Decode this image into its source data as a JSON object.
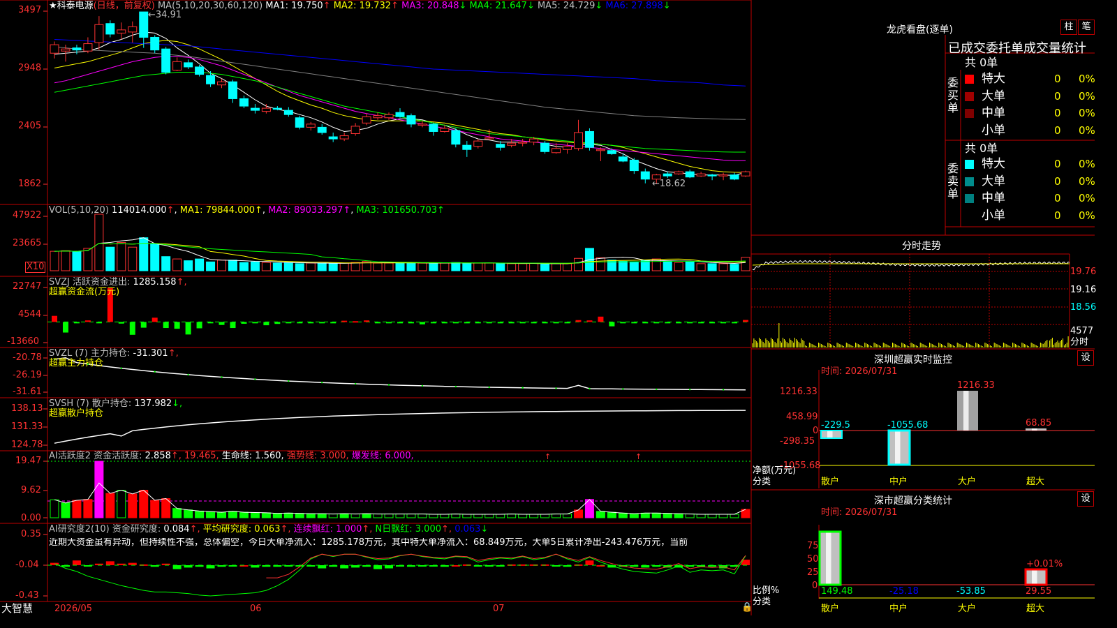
{
  "header": {
    "star": "★",
    "stock": "科泰电源",
    "mode": "(日线，前复权)",
    "ma_prefix": "MA(5,10,20,30,60,120)",
    "ma": [
      {
        "label": "MA1: 19.750",
        "arrow": "↑",
        "color": "#ffffff"
      },
      {
        "label": "MA2: 19.732",
        "arrow": "↑",
        "color": "#ffff00"
      },
      {
        "label": "MA3: 20.848",
        "arrow": "↓",
        "color": "#ff00ff"
      },
      {
        "label": "MA4: 21.647",
        "arrow": "↓",
        "color": "#00ff00"
      },
      {
        "label": "MA5: 24.729",
        "arrow": "↓",
        "color": "#c0c0c0"
      },
      {
        "label": "MA6: 27.898",
        "arrow": "↓",
        "color": "#0000ff"
      }
    ]
  },
  "colors": {
    "up": "#ff3232",
    "down": "#00ffff",
    "red": "#ff0000",
    "green": "#00ff00",
    "grid": "#c00000",
    "yellow": "#ffff00",
    "magenta": "#ff00ff",
    "blue": "#0000ff"
  },
  "price": {
    "y_labels": [
      "3497",
      "2948",
      "2405",
      "1862"
    ],
    "high_label": "34.91",
    "low_label": "←18.62",
    "high_prefix": "←"
  },
  "vol": {
    "title": "VOL(5,10,20)",
    "value": "114014.000",
    "arrow": "↑",
    "ma1": "MA1: 79844.000↑",
    "ma2": "MA2: 89033.297↑",
    "ma3": "MA3: 101650.703↑",
    "y_labels": [
      "47922",
      "23665"
    ],
    "mult": "X10"
  },
  "svzj": {
    "title": "SVZJ  活跃资金进出:",
    "value": "1285.158",
    "arrow": "↑,",
    "sub": "超赢资金流(万元)",
    "y_labels": [
      "22747",
      "4544",
      "-13660"
    ]
  },
  "svzl": {
    "title": "SVZL (7) 主力持仓:",
    "value": "-31.301",
    "arrow": "↑,",
    "sub": "超赢主力持仓",
    "y_labels": [
      "-20.78",
      "-26.19",
      "-31.61"
    ]
  },
  "svsh": {
    "title": "SVSH (7) 散户持仓:",
    "value": "137.982",
    "arrow": "↓,",
    "sub": "超赢散户持仓",
    "y_labels": [
      "138.13",
      "131.33",
      "124.78"
    ]
  },
  "ai2": {
    "title": "AI活跃度2 资金活跃度:",
    "value": "2.858",
    "v2": "↑, 19.465,",
    "life": "生命线: 1.560,",
    "strong": "强势线: 3.000,",
    "burst": "爆发线: 6.000,",
    "y_labels": [
      "19.47",
      "9.62",
      "0.00"
    ]
  },
  "ai_res": {
    "title": "AI研究度2(10) 资金研究度:",
    "value": "0.084",
    "v1": "↑,",
    "avg": "平均研究度: 0.063",
    "v2": "↑,",
    "cont": "连续飘红: 1.000",
    "v3": "↑,",
    "nday": "N日飘红: 3.000",
    "v4": "↑,",
    "last": "0.063",
    "v5": "↓",
    "note": "近期大资金虽有异动，但持续性不强，总体偏空，今日大单净流入：1285.178万元，其中特大单净流入：68.849万元，大单5日累计净出-243.476万元，当前",
    "y_labels": [
      "0.35",
      "-0.04",
      "-0.43"
    ]
  },
  "xaxis": {
    "labels": [
      "2026/05",
      "06",
      "07"
    ],
    "brand": "大智慧"
  },
  "longhu": {
    "title": "龙虎看盘(逐单)",
    "btn1": "柱",
    "btn2": "笔",
    "sub": "已成交委托单成交量统计",
    "buy_total": "共 0单",
    "buy_label": "委买单",
    "sell_total": "共 0单",
    "sell_label": "委卖单",
    "rows_buy": [
      {
        "name": "特大",
        "v": "0",
        "p": "0%",
        "color": "#ff0000"
      },
      {
        "name": "大单",
        "v": "0",
        "p": "0%",
        "color": "#a00000"
      },
      {
        "name": "中单",
        "v": "0",
        "p": "0%",
        "color": "#800000"
      },
      {
        "name": "小单",
        "v": "0",
        "p": "0%",
        "color": ""
      }
    ],
    "rows_sell": [
      {
        "name": "特大",
        "v": "0",
        "p": "0%",
        "color": "#00ffff"
      },
      {
        "name": "大单",
        "v": "0",
        "p": "0%",
        "color": "#008c8c"
      },
      {
        "name": "中单",
        "v": "0",
        "p": "0%",
        "color": "#008080"
      },
      {
        "name": "小单",
        "v": "0",
        "p": "0%",
        "color": ""
      }
    ]
  },
  "fenshi": {
    "title": "分时走势",
    "y_labels": [
      "19.76",
      "19.16",
      "18.56"
    ],
    "vol_label": "4577",
    "unit": "分时"
  },
  "monitor": {
    "title": "深圳超赢实时监控",
    "btn": "设",
    "time": "时间: 2026/07/31",
    "ylabel": "净额(万元)",
    "cat_label": "分类",
    "y_labels": [
      "1216.33",
      "458.99",
      "0",
      "-298.35",
      "-1055.68"
    ],
    "categories": [
      "散户",
      "中户",
      "大户",
      "超大"
    ],
    "values": [
      "-229.5",
      "-1055.68",
      "1216.33",
      "68.85"
    ]
  },
  "classify": {
    "title": "深市超赢分类统计",
    "btn": "设",
    "time": "时间: 2026/07/31",
    "ylabel": "比例%",
    "cat_label": "分类",
    "y_labels": [
      "75",
      "50",
      "25",
      "0"
    ],
    "categories": [
      "散户",
      "中户",
      "大户",
      "超大"
    ],
    "values": [
      "149.48",
      "-25.18",
      "-53.85",
      "29.55"
    ],
    "extra": "+0.01%"
  },
  "chart_data": {
    "type": "candlestick",
    "title": "科泰电源 (日线，前复权)",
    "x_month_labels": [
      "2026/05",
      "06",
      "07"
    ],
    "candles": [
      {
        "o": 31.0,
        "h": 32.1,
        "l": 30.5,
        "c": 31.8
      },
      {
        "o": 31.2,
        "h": 31.8,
        "l": 30.2,
        "c": 31.4
      },
      {
        "o": 31.5,
        "h": 31.8,
        "l": 30.9,
        "c": 31.3
      },
      {
        "o": 31.2,
        "h": 32.5,
        "l": 31.0,
        "c": 31.9
      },
      {
        "o": 32.0,
        "h": 34.5,
        "l": 31.3,
        "c": 33.7
      },
      {
        "o": 33.8,
        "h": 34.1,
        "l": 32.5,
        "c": 32.8
      },
      {
        "o": 32.9,
        "h": 33.9,
        "l": 32.3,
        "c": 33.2
      },
      {
        "o": 33.0,
        "h": 34.0,
        "l": 32.0,
        "c": 33.5
      },
      {
        "o": 34.9,
        "h": 34.91,
        "l": 31.5,
        "c": 32.5
      },
      {
        "o": 32.5,
        "h": 32.7,
        "l": 31.0,
        "c": 31.3
      },
      {
        "o": 31.4,
        "h": 31.6,
        "l": 29.0,
        "c": 29.2
      },
      {
        "o": 29.4,
        "h": 30.6,
        "l": 29.3,
        "c": 30.2
      },
      {
        "o": 30.1,
        "h": 30.4,
        "l": 29.5,
        "c": 29.7
      },
      {
        "o": 29.7,
        "h": 29.9,
        "l": 28.8,
        "c": 29.0
      },
      {
        "o": 28.9,
        "h": 29.3,
        "l": 27.8,
        "c": 28.1
      },
      {
        "o": 28.0,
        "h": 28.6,
        "l": 27.7,
        "c": 28.3
      },
      {
        "o": 28.3,
        "h": 28.5,
        "l": 26.3,
        "c": 26.7
      },
      {
        "o": 26.7,
        "h": 27.0,
        "l": 25.8,
        "c": 26.0
      },
      {
        "o": 25.8,
        "h": 26.2,
        "l": 25.3,
        "c": 25.6
      },
      {
        "o": 25.5,
        "h": 26.2,
        "l": 25.3,
        "c": 25.8
      },
      {
        "o": 25.8,
        "h": 26.0,
        "l": 25.6,
        "c": 25.7
      },
      {
        "o": 25.6,
        "h": 25.9,
        "l": 25.0,
        "c": 25.2
      },
      {
        "o": 24.9,
        "h": 25.1,
        "l": 23.8,
        "c": 24.0
      },
      {
        "o": 24.0,
        "h": 24.5,
        "l": 23.7,
        "c": 24.3
      },
      {
        "o": 24.0,
        "h": 24.3,
        "l": 23.3,
        "c": 23.5
      },
      {
        "o": 23.1,
        "h": 23.5,
        "l": 22.6,
        "c": 22.9
      },
      {
        "o": 22.9,
        "h": 23.5,
        "l": 22.7,
        "c": 23.2
      },
      {
        "o": 23.4,
        "h": 24.4,
        "l": 23.2,
        "c": 24.1
      },
      {
        "o": 24.4,
        "h": 25.3,
        "l": 24.2,
        "c": 25.0
      },
      {
        "o": 24.9,
        "h": 25.4,
        "l": 24.7,
        "c": 25.1
      },
      {
        "o": 24.9,
        "h": 25.4,
        "l": 24.7,
        "c": 25.2
      },
      {
        "o": 25.4,
        "h": 25.8,
        "l": 24.9,
        "c": 25.0
      },
      {
        "o": 25.1,
        "h": 25.3,
        "l": 24.0,
        "c": 24.3
      },
      {
        "o": 24.2,
        "h": 24.6,
        "l": 24.0,
        "c": 24.3
      },
      {
        "o": 24.3,
        "h": 24.4,
        "l": 23.2,
        "c": 23.6
      },
      {
        "o": 23.6,
        "h": 24.2,
        "l": 23.5,
        "c": 23.9
      },
      {
        "o": 23.7,
        "h": 23.9,
        "l": 22.1,
        "c": 22.4
      },
      {
        "o": 22.3,
        "h": 22.7,
        "l": 21.2,
        "c": 21.9
      },
      {
        "o": 22.2,
        "h": 22.9,
        "l": 22.0,
        "c": 22.7
      },
      {
        "o": 22.9,
        "h": 23.8,
        "l": 22.8,
        "c": 23.0
      },
      {
        "o": 22.4,
        "h": 22.7,
        "l": 21.8,
        "c": 22.1
      },
      {
        "o": 22.3,
        "h": 22.9,
        "l": 22.1,
        "c": 22.5
      },
      {
        "o": 22.5,
        "h": 22.9,
        "l": 22.2,
        "c": 22.6
      },
      {
        "o": 22.6,
        "h": 23.1,
        "l": 22.3,
        "c": 22.9
      },
      {
        "o": 22.5,
        "h": 22.7,
        "l": 21.5,
        "c": 21.7
      },
      {
        "o": 21.6,
        "h": 22.5,
        "l": 21.5,
        "c": 22.0
      },
      {
        "o": 21.9,
        "h": 22.5,
        "l": 21.5,
        "c": 22.2
      },
      {
        "o": 22.0,
        "h": 24.7,
        "l": 21.8,
        "c": 23.5
      },
      {
        "o": 23.6,
        "h": 23.9,
        "l": 21.8,
        "c": 22.1
      },
      {
        "o": 21.8,
        "h": 22.1,
        "l": 20.8,
        "c": 21.9
      },
      {
        "o": 21.8,
        "h": 22.0,
        "l": 21.4,
        "c": 21.5
      },
      {
        "o": 21.2,
        "h": 21.5,
        "l": 20.7,
        "c": 20.8
      },
      {
        "o": 20.9,
        "h": 21.1,
        "l": 19.6,
        "c": 19.9
      },
      {
        "o": 19.8,
        "h": 20.1,
        "l": 18.7,
        "c": 19.1
      },
      {
        "o": 19.1,
        "h": 19.6,
        "l": 18.62,
        "c": 19.5
      },
      {
        "o": 19.6,
        "h": 19.8,
        "l": 19.2,
        "c": 19.4
      },
      {
        "o": 19.6,
        "h": 19.9,
        "l": 19.5,
        "c": 19.8
      },
      {
        "o": 19.8,
        "h": 20.0,
        "l": 19.2,
        "c": 19.3
      },
      {
        "o": 19.4,
        "h": 19.8,
        "l": 19.3,
        "c": 19.6
      },
      {
        "o": 19.5,
        "h": 19.6,
        "l": 19.0,
        "c": 19.4
      },
      {
        "o": 19.4,
        "h": 19.7,
        "l": 19.0,
        "c": 19.5
      },
      {
        "o": 19.5,
        "h": 19.7,
        "l": 19.0,
        "c": 19.1
      },
      {
        "o": 19.4,
        "h": 19.9,
        "l": 19.3,
        "c": 19.8
      }
    ],
    "ma_lines": [
      {
        "name": "MA1",
        "values": [
          30.9,
          31.0,
          31.1,
          31.2,
          31.5,
          32.0,
          32.3,
          32.7,
          33.0,
          32.9,
          32.4,
          31.5,
          30.8,
          30.0,
          29.1,
          28.6,
          28.0,
          27.3,
          26.6,
          26.0,
          25.7,
          25.5,
          25.2,
          24.9,
          24.5,
          24.0,
          23.6,
          23.7,
          23.9,
          24.3,
          24.6,
          24.8,
          24.8,
          24.7,
          24.4,
          24.2,
          23.8,
          23.3,
          22.9,
          22.8,
          22.6,
          22.6,
          22.6,
          22.7,
          22.4,
          22.2,
          22.1,
          22.3,
          22.4,
          22.3,
          21.9,
          21.5,
          20.9,
          20.5,
          20.1,
          19.8,
          19.7,
          19.6,
          19.5,
          19.5,
          19.5,
          19.45,
          19.75
        ]
      },
      {
        "name": "MA2",
        "values": [
          29.6,
          29.8,
          30.0,
          30.2,
          30.5,
          30.8,
          31.1,
          31.5,
          31.9,
          32.1,
          32.2,
          32.1,
          31.8,
          31.4,
          30.9,
          30.4,
          29.8,
          29.2,
          28.6,
          28.0,
          27.4,
          26.9,
          26.5,
          26.1,
          25.8,
          25.4,
          25.1,
          24.9,
          24.7,
          24.6,
          24.6,
          24.6,
          24.6,
          24.6,
          24.5,
          24.4,
          24.2,
          24.0,
          23.8,
          23.6,
          23.4,
          23.3,
          23.1,
          23.0,
          22.8,
          22.7,
          22.6,
          22.5,
          22.5,
          22.4,
          22.3,
          22.1,
          21.8,
          21.5,
          21.2,
          20.9,
          20.6,
          20.3,
          20.1,
          19.9,
          19.8,
          19.75,
          19.73
        ]
      },
      {
        "name": "MA3",
        "values": [
          28.2,
          28.4,
          28.7,
          29.0,
          29.3,
          29.6,
          29.9,
          30.2,
          30.4,
          30.6,
          30.7,
          30.7,
          30.6,
          30.4,
          30.1,
          29.8,
          29.4,
          29.0,
          28.6,
          28.2,
          27.8,
          27.4,
          27.0,
          26.7,
          26.4,
          26.1,
          25.8,
          25.5,
          25.3,
          25.1,
          24.9,
          24.7,
          24.5,
          24.3,
          24.1,
          23.9,
          23.7,
          23.5,
          23.3,
          23.1,
          22.9,
          22.8,
          22.7,
          22.6,
          22.5,
          22.4,
          22.3,
          22.2,
          22.1,
          22.0,
          21.9,
          21.8,
          21.7,
          21.6,
          21.5,
          21.4,
          21.3,
          21.2,
          21.1,
          21.0,
          20.9,
          20.85,
          20.85
        ]
      },
      {
        "name": "MA4",
        "values": [
          27.3,
          27.5,
          27.7,
          27.9,
          28.1,
          28.3,
          28.5,
          28.7,
          28.9,
          29.0,
          29.1,
          29.2,
          29.2,
          29.2,
          29.1,
          29.0,
          28.8,
          28.6,
          28.4,
          28.1,
          27.8,
          27.5,
          27.2,
          26.9,
          26.6,
          26.3,
          26.0,
          25.8,
          25.6,
          25.4,
          25.2,
          25.0,
          24.8,
          24.6,
          24.4,
          24.2,
          24.0,
          23.8,
          23.6,
          23.4,
          23.3,
          23.2,
          23.1,
          23.0,
          22.9,
          22.8,
          22.7,
          22.6,
          22.5,
          22.4,
          22.3,
          22.2,
          22.1,
          22.0,
          21.95,
          21.9,
          21.85,
          21.8,
          21.75,
          21.7,
          21.67,
          21.65,
          21.65
        ]
      },
      {
        "name": "MA5",
        "values": [
          31.6,
          31.5,
          31.4,
          31.3,
          31.25,
          31.2,
          31.15,
          31.1,
          31.05,
          31.0,
          30.9,
          30.8,
          30.7,
          30.55,
          30.4,
          30.25,
          30.1,
          29.95,
          29.8,
          29.65,
          29.5,
          29.35,
          29.2,
          29.05,
          28.9,
          28.75,
          28.6,
          28.45,
          28.3,
          28.15,
          28.0,
          27.85,
          27.7,
          27.55,
          27.4,
          27.25,
          27.1,
          26.95,
          26.8,
          26.65,
          26.5,
          26.35,
          26.2,
          26.05,
          25.9,
          25.8,
          25.7,
          25.6,
          25.5,
          25.4,
          25.3,
          25.2,
          25.1,
          25.05,
          25.0,
          24.95,
          24.9,
          24.87,
          24.84,
          24.8,
          24.77,
          24.75,
          24.73
        ]
      },
      {
        "name": "MA6",
        "values": [
          32.3,
          32.25,
          32.2,
          32.15,
          32.1,
          32.05,
          32.0,
          31.95,
          31.9,
          31.85,
          31.8,
          31.75,
          31.7,
          31.6,
          31.5,
          31.4,
          31.3,
          31.2,
          31.1,
          31.0,
          30.9,
          30.8,
          30.7,
          30.6,
          30.5,
          30.4,
          30.3,
          30.2,
          30.1,
          30.0,
          29.9,
          29.8,
          29.7,
          29.6,
          29.5,
          29.45,
          29.4,
          29.35,
          29.3,
          29.25,
          29.2,
          29.15,
          29.1,
          29.05,
          29.0,
          28.95,
          28.9,
          28.85,
          28.8,
          28.75,
          28.7,
          28.65,
          28.6,
          28.5,
          28.4,
          28.35,
          28.3,
          28.25,
          28.2,
          28.1,
          28.0,
          27.95,
          27.9
        ]
      }
    ],
    "volume": [
      16500,
      17000,
      16000,
      19000,
      47922,
      20000,
      24000,
      20000,
      28000,
      23000,
      12000,
      10000,
      8500,
      10000,
      7500,
      9000,
      9000,
      7000,
      7500,
      7000,
      6500,
      7000,
      6000,
      6500,
      6500,
      6000,
      6500,
      7000,
      8000,
      6500,
      6500,
      7000,
      6500,
      6500,
      6000,
      6500,
      7000,
      6500,
      6500,
      6500,
      6000,
      6000,
      6000,
      6500,
      5500,
      6000,
      6000,
      10500,
      19000,
      11000,
      9000,
      8000,
      7500,
      9000,
      10000,
      8000,
      7000,
      7500,
      6000,
      6000,
      6000,
      5500,
      11401
    ],
    "svzj": [
      4000,
      -7000,
      -600,
      1000,
      -900,
      22747,
      -1100,
      -8500,
      -3800,
      2800,
      -4000,
      -4500,
      -8300,
      -4200,
      -400,
      -2000,
      -4000,
      -1200,
      -800,
      -2200,
      -1300,
      -500,
      -500,
      -500,
      -500,
      -400,
      800,
      500,
      1000,
      -800,
      -900,
      -600,
      -400,
      -1600,
      -500,
      -800,
      -300,
      -500,
      -200,
      -300,
      -400,
      -300,
      -400,
      -200,
      -300,
      -200,
      -300,
      1200,
      1000,
      3500,
      -2900,
      -300,
      -400,
      -300,
      -200,
      -300,
      -200,
      -400,
      -300,
      -200,
      -300,
      -200,
      1285
    ]
  }
}
